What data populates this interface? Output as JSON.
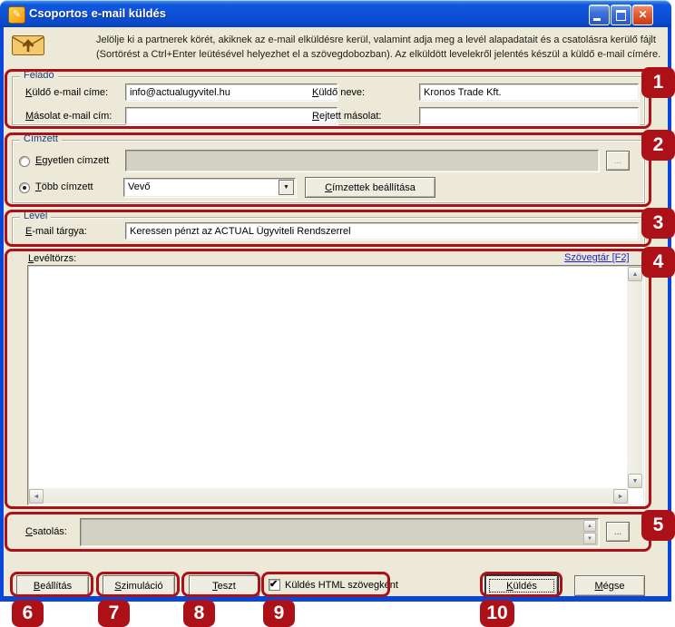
{
  "window": {
    "title": "Csoportos e-mail küldés"
  },
  "icons": {
    "app_glyph": "✎",
    "close_glyph": "✕",
    "dots": "...",
    "combo_arrow": "▼",
    "check": "✔",
    "up": "▲",
    "down": "▼",
    "left": "◄",
    "right": "►"
  },
  "header": {
    "line1": "Jelölje ki a partnerek körét, akiknek az e-mail elküldésre kerül, valamint adja meg a levél alapadatait és a csatolásra kerülő fájlt",
    "line2": "(Sortörést a Ctrl+Enter leütésével helyezhet el a szövegdobozban). Az elküldött levelekről jelentés készül a küldő e-mail címére."
  },
  "felado": {
    "legend": "Feladó",
    "kuldo_email_label": "Küldő e-mail címe:",
    "kuldo_email_value": "info@actualugyvitel.hu",
    "kuldo_neve_label": "Küldő neve:",
    "kuldo_neve_value": "Kronos Trade Kft.",
    "masolat_label": "Másolat e-mail cím:",
    "masolat_value": "",
    "rejtett_label": "Rejtett másolat:",
    "rejtett_value": ""
  },
  "cimzett": {
    "legend": "Címzett",
    "egyetlen_label": "Egyetlen címzett",
    "egyetlen_value": "",
    "egyetlen_selected": false,
    "tobb_label": "Több címzett",
    "tobb_selected": true,
    "dropdown_value": "Vevő",
    "cimzettek_button": "Címzettek beállítása"
  },
  "level": {
    "legend": "Levél",
    "targy_label": "E-mail tárgya:",
    "targy_value": "Keressen pénzt az ACTUAL Ügyviteli Rendszerrel"
  },
  "leveltorzs": {
    "label": "Levéltörzs:",
    "szovegtar_link": "Szövegtár [F2]",
    "body_value": ""
  },
  "csatolas": {
    "label": "Csatolás:",
    "value": ""
  },
  "footer": {
    "beallitas": "Beállítás",
    "szimulacio": "Szimuláció",
    "teszt": "Teszt",
    "html_checkbox_label": "Küldés HTML szövegként",
    "html_checkbox_checked": true,
    "kuldes": "Küldés",
    "megse": "Mégse"
  },
  "annotations": {
    "color": "#AD1118",
    "badges": [
      "1",
      "2",
      "3",
      "4",
      "5",
      "6",
      "7",
      "8",
      "9",
      "10"
    ]
  }
}
